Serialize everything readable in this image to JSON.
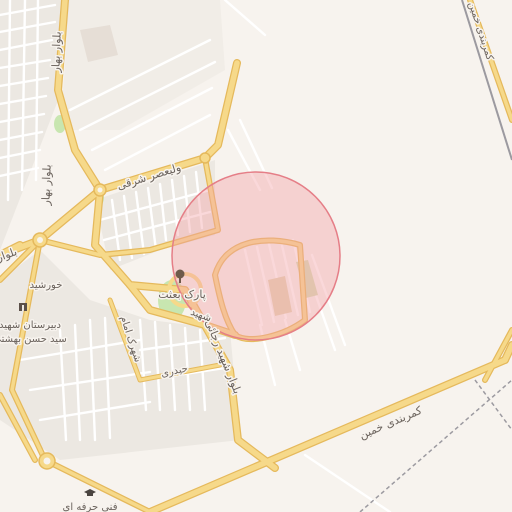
{
  "map": {
    "colors": {
      "land": "#f7f3ee",
      "residential": "#ece8e2",
      "major_road": "#f6d98a",
      "major_road_casing": "#e5b95c",
      "minor_road": "#ffffff",
      "railway": "#9c9aa0",
      "park": "#c8e6b0",
      "sports": "#e3d4b4",
      "radius_fill": "#f4a2a8",
      "radius_stroke": "#e57e87"
    },
    "roads": {
      "boulevard_bahar": "بلوار بهار",
      "boulevard_unnamed": "بلوار",
      "valiasr_east": "ولیعصر شرقی",
      "boulevard_shahid_rajaei": "بلوار شهید رجائی",
      "khomeini_beltway": "کمربندی خمین",
      "khomeini_beltway_ne": "کمربندی خمین",
      "shahid_street": "شهید",
      "heydari": "حیدری",
      "shahrak_emam": "شهرک امام"
    },
    "places": {
      "park_besat": "پارک بعثت",
      "khorshid": "خورشید",
      "school_line1": "دبیرستان شهید",
      "school_line2": "سید حسن بهشتی",
      "vocational": "فنی حرفه ای"
    },
    "icons": {
      "park": "tree-icon",
      "school": "school-icon",
      "university": "graduation-cap-icon"
    }
  }
}
